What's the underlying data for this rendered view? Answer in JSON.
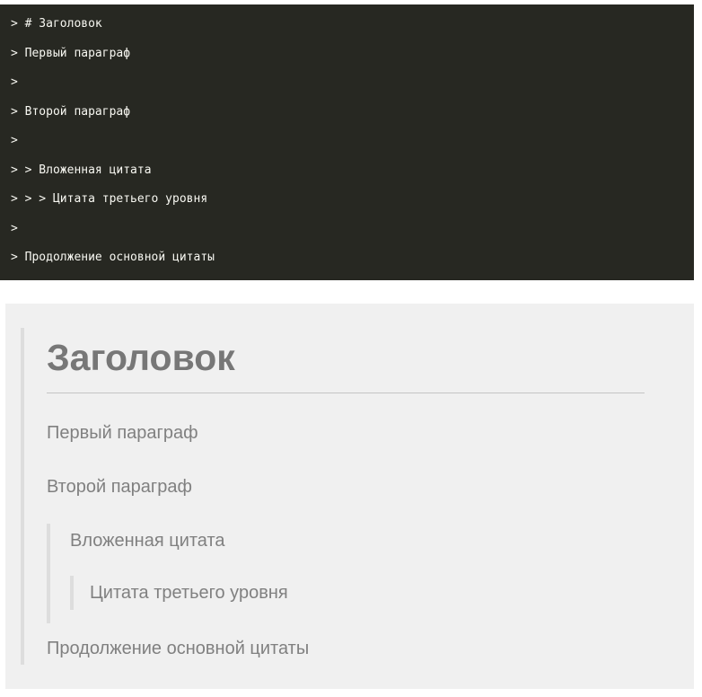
{
  "source": {
    "lines": [
      "> # Заголовок",
      "> Первый параграф",
      ">",
      "> Второй параграф",
      ">",
      "> > Вложенная цитата",
      "> > > Цитата третьего уровня",
      ">",
      "> Продолжение основной цитаты"
    ]
  },
  "preview": {
    "heading": "Заголовок",
    "paragraph_1": "Первый параграф",
    "paragraph_2": "Второй параграф",
    "nested_quote": "Вложенная цитата",
    "third_level_quote": "Цитата третьего уровня",
    "continuation": "Продолжение основной цитаты"
  },
  "colors": {
    "code_background": "#272822",
    "code_text": "#f8f8f2",
    "preview_background": "#f0f0f0",
    "quote_border": "#dddddd",
    "quote_text": "#808080",
    "heading_text": "#777777"
  }
}
